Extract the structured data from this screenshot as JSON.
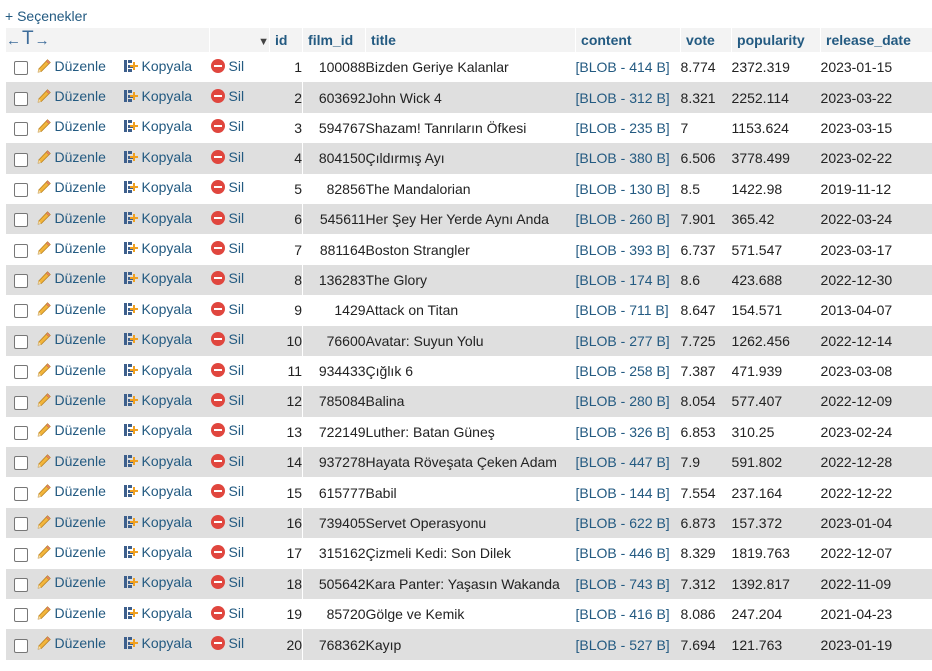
{
  "options_label": "+ Seçenekler",
  "actions": {
    "edit": "Düzenle",
    "copy": "Kopyala",
    "delete": "Sil"
  },
  "columns": [
    "id",
    "film_id",
    "title",
    "content",
    "vote",
    "popularity",
    "release_date"
  ],
  "sort_indicator": "▼",
  "rows": [
    {
      "id": "1",
      "film_id": "100088",
      "title": "Bizden Geriye Kalanlar",
      "content": "[BLOB - 414 B]",
      "vote": "8.774",
      "popularity": "2372.319",
      "release_date": "2023-01-15"
    },
    {
      "id": "2",
      "film_id": "603692",
      "title": "John Wick 4",
      "content": "[BLOB - 312 B]",
      "vote": "8.321",
      "popularity": "2252.114",
      "release_date": "2023-03-22"
    },
    {
      "id": "3",
      "film_id": "594767",
      "title": "Shazam! Tanrıların Öfkesi",
      "content": "[BLOB - 235 B]",
      "vote": "7",
      "popularity": "1153.624",
      "release_date": "2023-03-15"
    },
    {
      "id": "4",
      "film_id": "804150",
      "title": "Çıldırmış Ayı",
      "content": "[BLOB - 380 B]",
      "vote": "6.506",
      "popularity": "3778.499",
      "release_date": "2023-02-22"
    },
    {
      "id": "5",
      "film_id": "82856",
      "title": "The Mandalorian",
      "content": "[BLOB - 130 B]",
      "vote": "8.5",
      "popularity": "1422.98",
      "release_date": "2019-11-12"
    },
    {
      "id": "6",
      "film_id": "545611",
      "title": "Her Şey Her Yerde Aynı Anda",
      "content": "[BLOB - 260 B]",
      "vote": "7.901",
      "popularity": "365.42",
      "release_date": "2022-03-24"
    },
    {
      "id": "7",
      "film_id": "881164",
      "title": "Boston Strangler",
      "content": "[BLOB - 393 B]",
      "vote": "6.737",
      "popularity": "571.547",
      "release_date": "2023-03-17"
    },
    {
      "id": "8",
      "film_id": "136283",
      "title": "The Glory",
      "content": "[BLOB - 174 B]",
      "vote": "8.6",
      "popularity": "423.688",
      "release_date": "2022-12-30"
    },
    {
      "id": "9",
      "film_id": "1429",
      "title": "Attack on Titan",
      "content": "[BLOB - 711 B]",
      "vote": "8.647",
      "popularity": "154.571",
      "release_date": "2013-04-07"
    },
    {
      "id": "10",
      "film_id": "76600",
      "title": "Avatar: Suyun Yolu",
      "content": "[BLOB - 277 B]",
      "vote": "7.725",
      "popularity": "1262.456",
      "release_date": "2022-12-14"
    },
    {
      "id": "11",
      "film_id": "934433",
      "title": "Çığlık 6",
      "content": "[BLOB - 258 B]",
      "vote": "7.387",
      "popularity": "471.939",
      "release_date": "2023-03-08"
    },
    {
      "id": "12",
      "film_id": "785084",
      "title": "Balina",
      "content": "[BLOB - 280 B]",
      "vote": "8.054",
      "popularity": "577.407",
      "release_date": "2022-12-09"
    },
    {
      "id": "13",
      "film_id": "722149",
      "title": "Luther: Batan Güneş",
      "content": "[BLOB - 326 B]",
      "vote": "6.853",
      "popularity": "310.25",
      "release_date": "2023-02-24"
    },
    {
      "id": "14",
      "film_id": "937278",
      "title": "Hayata Röveşata Çeken Adam",
      "content": "[BLOB - 447 B]",
      "vote": "7.9",
      "popularity": "591.802",
      "release_date": "2022-12-28"
    },
    {
      "id": "15",
      "film_id": "615777",
      "title": "Babil",
      "content": "[BLOB - 144 B]",
      "vote": "7.554",
      "popularity": "237.164",
      "release_date": "2022-12-22"
    },
    {
      "id": "16",
      "film_id": "739405",
      "title": "Servet Operasyonu",
      "content": "[BLOB - 622 B]",
      "vote": "6.873",
      "popularity": "157.372",
      "release_date": "2023-01-04"
    },
    {
      "id": "17",
      "film_id": "315162",
      "title": "Çizmeli Kedi: Son Dilek",
      "content": "[BLOB - 446 B]",
      "vote": "8.329",
      "popularity": "1819.763",
      "release_date": "2022-12-07"
    },
    {
      "id": "18",
      "film_id": "505642",
      "title": "Kara Panter: Yaşasın Wakanda",
      "content": "[BLOB - 743 B]",
      "vote": "7.312",
      "popularity": "1392.817",
      "release_date": "2022-11-09"
    },
    {
      "id": "19",
      "film_id": "85720",
      "title": "Gölge ve Kemik",
      "content": "[BLOB - 416 B]",
      "vote": "8.086",
      "popularity": "247.204",
      "release_date": "2021-04-23"
    },
    {
      "id": "20",
      "film_id": "768362",
      "title": "Kayıp",
      "content": "[BLOB - 527 B]",
      "vote": "7.694",
      "popularity": "121.763",
      "release_date": "2023-01-19"
    }
  ]
}
